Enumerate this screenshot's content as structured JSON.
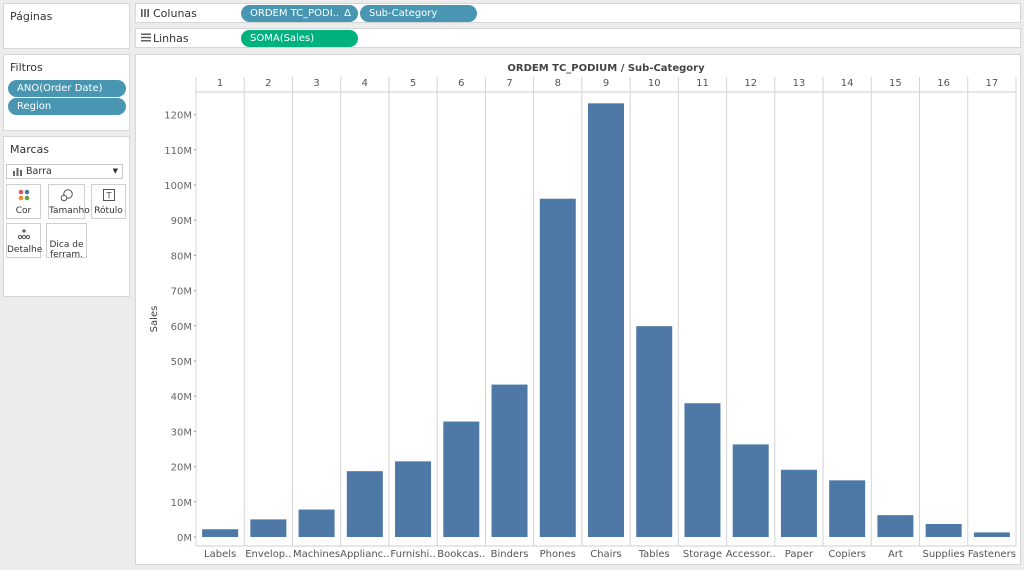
{
  "pages_panel": {
    "title": "Páginas"
  },
  "filters_panel": {
    "title": "Filtros",
    "pills": [
      "ANO(Order Date)",
      "Region"
    ]
  },
  "marks_panel": {
    "title": "Marcas",
    "mark_type": "Barra",
    "buttons": {
      "color": "Cor",
      "size": "Tamanho",
      "label": "Rótulo",
      "detail": "Detalhe",
      "tooltip_line1": "Dica de",
      "tooltip_line2": "ferram."
    }
  },
  "columns_shelf": {
    "label": "Colunas",
    "pills": [
      "ORDEM TC_PODI..",
      "Sub-Category"
    ],
    "delta_symbol": "Δ"
  },
  "rows_shelf": {
    "label": "Linhas",
    "pills": [
      "SOMA(Sales)"
    ]
  },
  "colors": {
    "bar": "#4e79a7",
    "pill_blue": "#4996b2",
    "pill_green": "#00b180"
  },
  "chart_data": {
    "type": "bar",
    "title": "ORDEM TC_PODIUM / Sub-Category",
    "ylabel": "Sales",
    "ylim": [
      0,
      128000000
    ],
    "yticks": [
      0,
      10000000,
      20000000,
      30000000,
      40000000,
      50000000,
      60000000,
      70000000,
      80000000,
      90000000,
      100000000,
      110000000,
      120000000
    ],
    "ytick_labels": [
      "0M",
      "10M",
      "20M",
      "30M",
      "40M",
      "50M",
      "60M",
      "70M",
      "80M",
      "90M",
      "100M",
      "110M",
      "120M"
    ],
    "ranks": [
      "1",
      "2",
      "3",
      "4",
      "5",
      "6",
      "7",
      "8",
      "9",
      "10",
      "11",
      "12",
      "13",
      "14",
      "15",
      "16",
      "17"
    ],
    "categories": [
      "Labels",
      "Envelop..",
      "Machines",
      "Applianc..",
      "Furnishi..",
      "Bookcas..",
      "Binders",
      "Phones",
      "Chairs",
      "Tables",
      "Storage",
      "Accessor..",
      "Paper",
      "Copiers",
      "Art",
      "Supplies",
      "Fasteners"
    ],
    "values": [
      2200000,
      5000000,
      7800000,
      18700000,
      21500000,
      32800000,
      43300000,
      96100000,
      123200000,
      59900000,
      38000000,
      26300000,
      19100000,
      16100000,
      6200000,
      3700000,
      1300000
    ],
    "grid": false
  }
}
